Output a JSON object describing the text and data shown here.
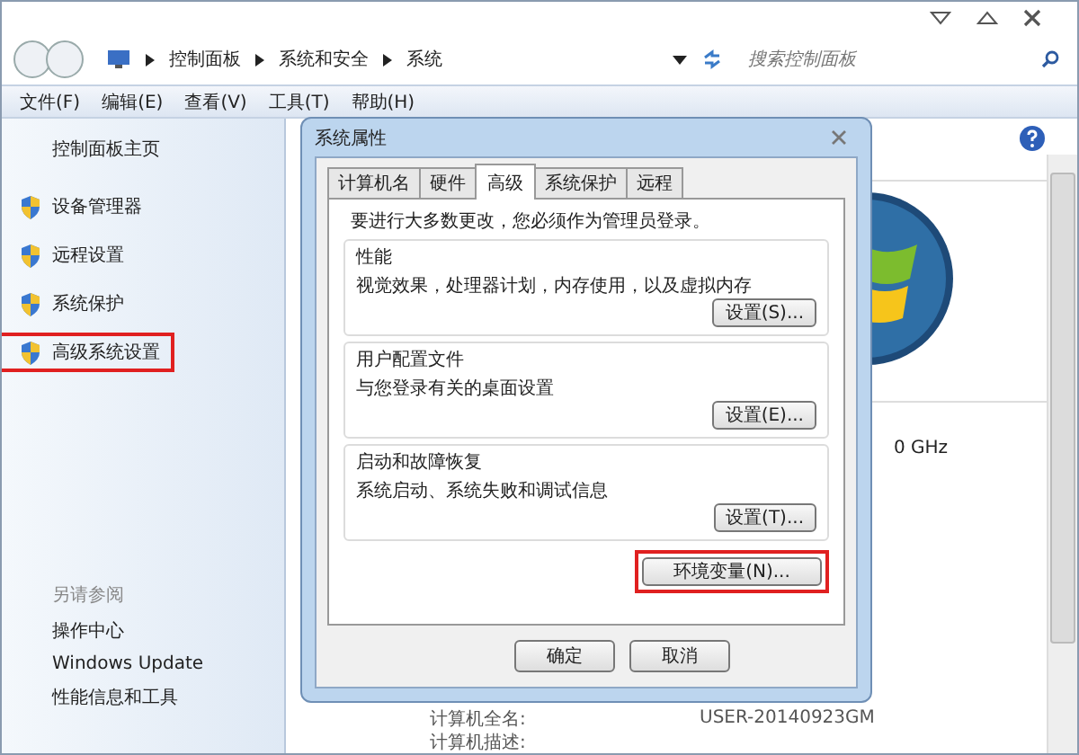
{
  "address_bar": {
    "crumbs": [
      "控制面板",
      "系统和安全",
      "系统"
    ],
    "search_placeholder": "搜索控制面板"
  },
  "menu": [
    "文件(F)",
    "编辑(E)",
    "查看(V)",
    "工具(T)",
    "帮助(H)"
  ],
  "sidebar": {
    "home": "控制面板主页",
    "items": [
      {
        "label": "设备管理器",
        "highlighted": false
      },
      {
        "label": "远程设置",
        "highlighted": false
      },
      {
        "label": "系统保护",
        "highlighted": false
      },
      {
        "label": "高级系统设置",
        "highlighted": true
      }
    ],
    "see_also_title": "另请参阅",
    "links": [
      "操作中心",
      "Windows Update",
      "性能信息和工具"
    ]
  },
  "main": {
    "speed_fragment": "0 GHz",
    "info_rows": [
      {
        "label": "计算机全名:",
        "value": "USER-20140923GM"
      },
      {
        "label": "计算机描述:"
      }
    ]
  },
  "dialog": {
    "title": "系统属性",
    "tabs": [
      {
        "label": "计算机名",
        "selected": false
      },
      {
        "label": "硬件",
        "selected": false
      },
      {
        "label": "高级",
        "selected": true
      },
      {
        "label": "系统保护",
        "selected": false
      },
      {
        "label": "远程",
        "selected": false
      }
    ],
    "notice": "要进行大多数更改，您必须作为管理员登录。",
    "groups": [
      {
        "title": "性能",
        "description": "视觉效果，处理器计划，内存使用，以及虚拟内存",
        "button": "设置(S)..."
      },
      {
        "title": "用户配置文件",
        "description": "与您登录有关的桌面设置",
        "button": "设置(E)..."
      },
      {
        "title": "启动和故障恢复",
        "description": "系统启动、系统失败和调试信息",
        "button": "设置(T)..."
      }
    ],
    "env_button": {
      "label": "环境变量(N)...",
      "highlighted": true
    },
    "buttons": [
      "确定",
      "取消"
    ]
  }
}
